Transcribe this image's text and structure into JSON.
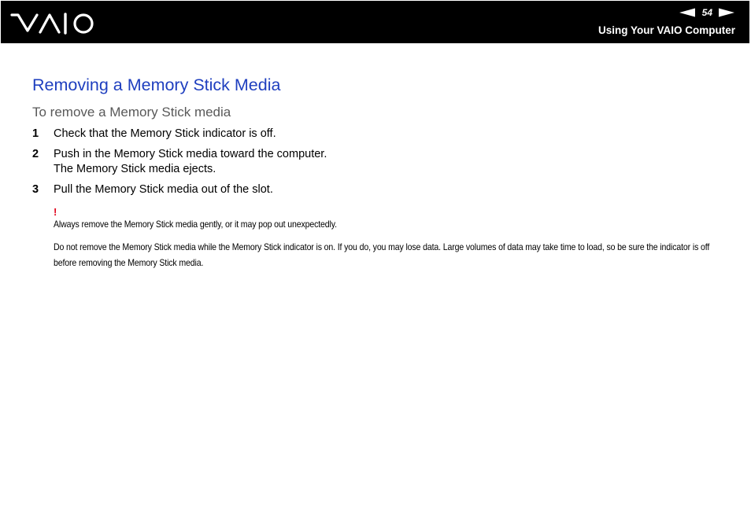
{
  "header": {
    "brand": "VAIO",
    "page_number": "54",
    "section_name": "Using Your VAIO Computer",
    "prev_icon": "triangle-left-icon",
    "next_icon": "triangle-right-icon"
  },
  "content": {
    "title": "Removing a Memory Stick Media",
    "subtitle": "To remove a Memory Stick media",
    "steps": [
      {
        "number": "1",
        "text": "Check that the Memory Stick indicator is off.",
        "subtext": ""
      },
      {
        "number": "2",
        "text": "Push in the Memory Stick media toward the computer.",
        "subtext": "The Memory Stick media ejects."
      },
      {
        "number": "3",
        "text": "Pull the Memory Stick media out of the slot.",
        "subtext": ""
      }
    ],
    "caution_mark": "!",
    "notes": [
      "Always remove the Memory Stick media gently, or it may pop out unexpectedly.",
      "Do not remove the Memory Stick media while the Memory Stick indicator is on. If you do, you may lose data. Large volumes of data may take time to load, so be sure the indicator is off before removing the Memory Stick media."
    ]
  },
  "colors": {
    "header_bg": "#000000",
    "title": "#1f3fbf",
    "subtitle": "#595959",
    "caution": "#e0001a"
  }
}
